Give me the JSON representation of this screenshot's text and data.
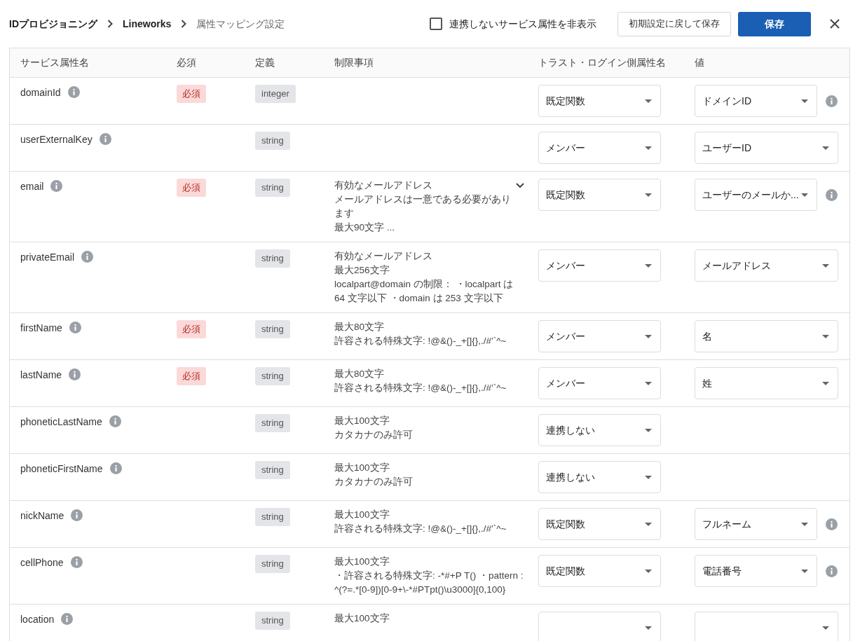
{
  "breadcrumb": [
    {
      "label": "IDプロビジョニング",
      "current": false
    },
    {
      "label": "Lineworks",
      "current": false
    },
    {
      "label": "属性マッピング設定",
      "current": true
    }
  ],
  "hide_unlinked": {
    "label": "連携しないサービス属性を非表示",
    "checked": false
  },
  "buttons": [
    {
      "label": "初期設定に戻して保存",
      "kind": "secondary"
    },
    {
      "label": "保存",
      "kind": "primary"
    }
  ],
  "columns": [
    "サービス属性名",
    "必須",
    "定義",
    "制限事項",
    "トラスト・ログイン側属性名",
    "値"
  ],
  "rows": [
    {
      "name": "domainId",
      "required": "必須",
      "type": "integer",
      "restrictions": [],
      "trust": {
        "label": "既定関数"
      },
      "value": {
        "label": "ドメインID",
        "info": true
      }
    },
    {
      "name": "userExternalKey",
      "type": "string",
      "restrictions": [],
      "trust": {
        "label": "メンバー"
      },
      "value": {
        "label": "ユーザーID",
        "info": false
      }
    },
    {
      "name": "email",
      "required": "必須",
      "type": "string",
      "restrictions": [
        "有効なメールアドレス",
        "メールアドレスは一意である必要があります",
        "最大90文字 ..."
      ],
      "expanded": false,
      "trust": {
        "label": "既定関数"
      },
      "value": {
        "label": "ユーザーのメールか...",
        "info": true
      }
    },
    {
      "name": "privateEmail",
      "type": "string",
      "restrictions": [
        "有効なメールアドレス",
        "最大256文字",
        "localpart@domain の制限： ・localpart は 64 文字以下 ・domain は 253 文字以下"
      ],
      "trust": {
        "label": "メンバー"
      },
      "value": {
        "label": "メールアドレス",
        "info": false
      }
    },
    {
      "name": "firstName",
      "required": "必須",
      "type": "string",
      "restrictions": [
        "最大80文字",
        "許容される特殊文字: !@&()-_+[]{},./#'`^~"
      ],
      "trust": {
        "label": "メンバー"
      },
      "value": {
        "label": "名",
        "info": false
      }
    },
    {
      "name": "lastName",
      "required": "必須",
      "type": "string",
      "restrictions": [
        "最大80文字",
        "許容される特殊文字: !@&()-_+[]{},./#'`^~"
      ],
      "trust": {
        "label": "メンバー"
      },
      "value": {
        "label": "姓",
        "info": false
      }
    },
    {
      "name": "phoneticLastName",
      "type": "string",
      "restrictions": [
        "最大100文字",
        "カタカナのみ許可"
      ],
      "trust": {
        "label": "連携しない"
      }
    },
    {
      "name": "phoneticFirstName",
      "type": "string",
      "restrictions": [
        "最大100文字",
        "カタカナのみ許可"
      ],
      "trust": {
        "label": "連携しない"
      }
    },
    {
      "name": "nickName",
      "type": "string",
      "restrictions": [
        "最大100文字",
        "許容される特殊文字: !@&()-_+[]{},./#'`^~"
      ],
      "trust": {
        "label": "既定関数"
      },
      "value": {
        "label": "フルネーム",
        "info": true
      }
    },
    {
      "name": "cellPhone",
      "type": "string",
      "restrictions": [
        "最大100文字",
        "・許容される特殊文字: -*#+P T() ・pattern : ^(?=.*[0-9])[0-9+\\-*#PTpt()\\u3000]{0,100}"
      ],
      "trust": {
        "label": "既定関数"
      },
      "value": {
        "label": "電話番号",
        "info": true
      }
    },
    {
      "name": "location",
      "type": "string",
      "restrictions": [
        "最大100文字"
      ],
      "trust": {},
      "value": {
        "info": false
      }
    }
  ]
}
